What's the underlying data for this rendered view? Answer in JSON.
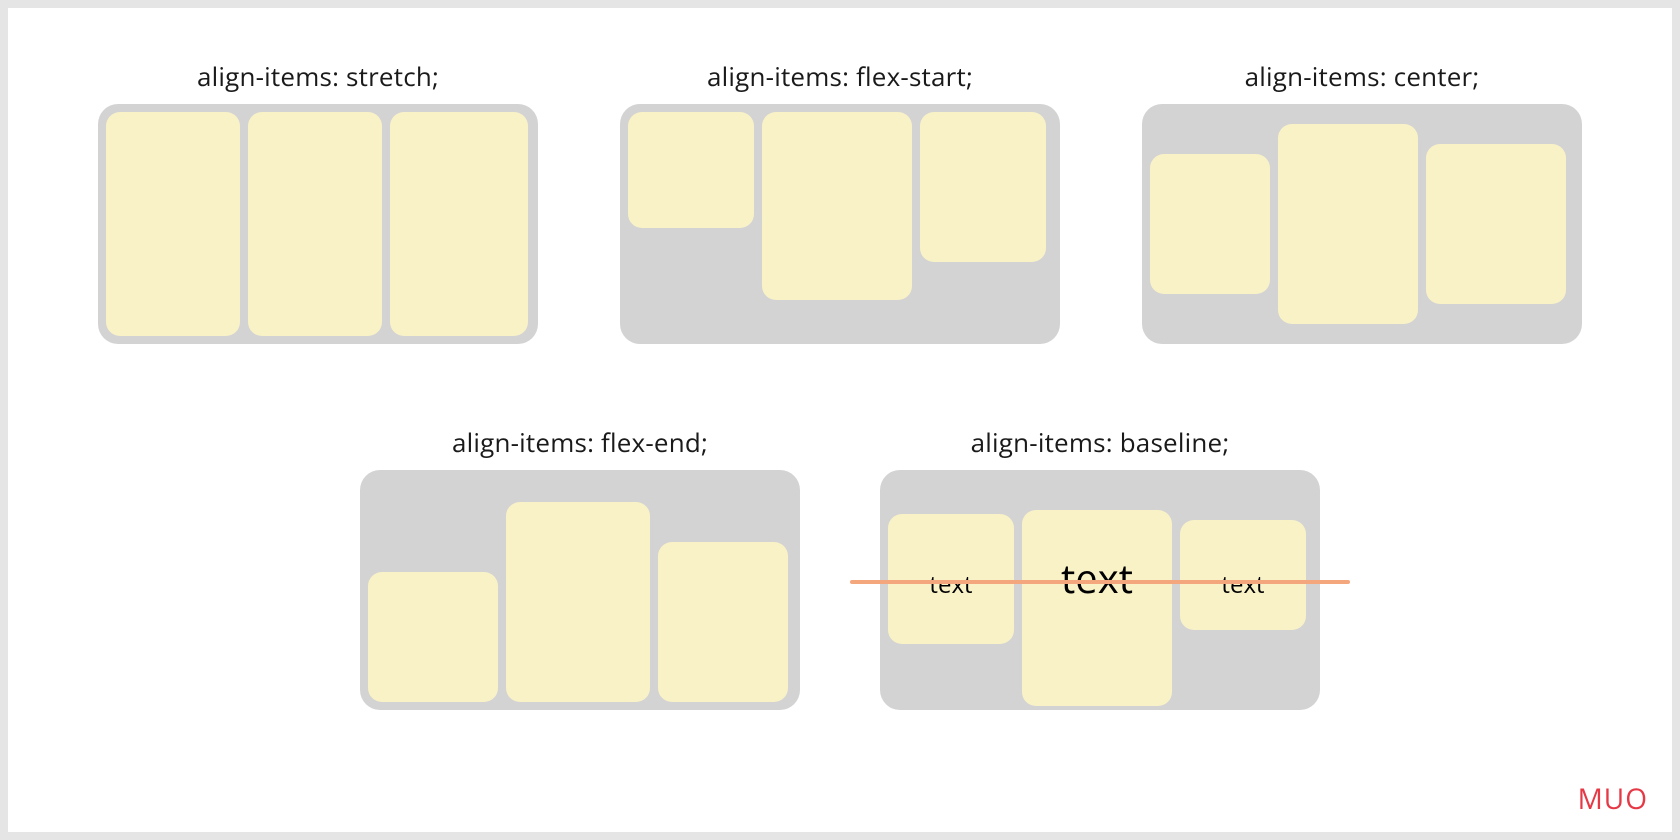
{
  "watermark": "MUO",
  "examples": {
    "stretch": {
      "title": "align-items: stretch;"
    },
    "flex_start": {
      "title": "align-items: flex-start;"
    },
    "center": {
      "title": "align-items: center;"
    },
    "flex_end": {
      "title": "align-items: flex-end;"
    },
    "baseline": {
      "title": "align-items: baseline;",
      "item_labels": [
        "text",
        "text",
        "text"
      ]
    }
  },
  "colors": {
    "container_bg": "#d3d3d3",
    "item_bg": "#f9f2c6",
    "baseline_line": "#f4a77d",
    "watermark": "#e63946"
  }
}
